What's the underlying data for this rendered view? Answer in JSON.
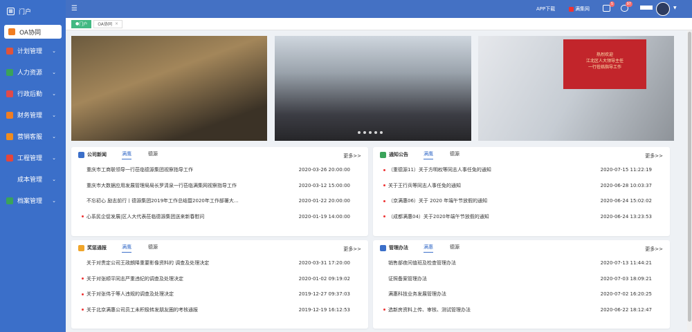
{
  "sidebar": {
    "home": "门户",
    "active": "OA协同",
    "items": [
      {
        "label": "计划管理",
        "color": "#e0533a"
      },
      {
        "label": "人力资源",
        "color": "#3aa35a"
      },
      {
        "label": "行政后勤",
        "color": "#e04a4a"
      },
      {
        "label": "财务管理",
        "color": "#f07d22"
      },
      {
        "label": "营销客服",
        "color": "#f08c1e"
      },
      {
        "label": "工程管理",
        "color": "#e5453a"
      },
      {
        "label": "成本管理",
        "color": "#3b6fc9"
      },
      {
        "label": "档案管理",
        "color": "#3aa35a"
      }
    ]
  },
  "topbar": {
    "app": "APP下载",
    "brand": "满集网",
    "msg_badge": "5",
    "user_badge": "97"
  },
  "tabs": [
    {
      "label": "门户"
    },
    {
      "label": "OA协同"
    }
  ],
  "banner3_text": "热烈欢迎\n江北区人大领导主任\n一行莅临指导工作",
  "more": "更多>>",
  "cards": [
    {
      "title": "公司新闻",
      "tab1": "满鹰",
      "tab2": "德源",
      "color": "#3b6fc9",
      "rows": [
        {
          "t": "重庆市工商联领导一行莅临德源集团视察指导工作",
          "d": "2020-03-26 20:00:00",
          "dot": false
        },
        {
          "t": "重庆市大数据应用发展管理局局长罗清泉一行莅临满集网视察指导工作",
          "d": "2020-03-12 15:00:00",
          "dot": false
        },
        {
          "t": "不忘初心 励志前行丨德源集团2019年工作总结暨2020年工作部署大...",
          "d": "2020-01-22 20:00:00",
          "dot": false
        },
        {
          "t": "心系民企促发展|区人大代表莅临德源集团送来新春慰问",
          "d": "2020-01-19 14:00:00",
          "dot": true
        }
      ]
    },
    {
      "title": "通知公告",
      "tab1": "满鹰",
      "tab2": "德源",
      "color": "#3aa35a",
      "rows": [
        {
          "t": "（重德源11）关于方明权等同志人事任免的通知",
          "d": "2020-07-15 11:22:19",
          "dot": true
        },
        {
          "t": "关于王行兵等同志人事任免的通知",
          "d": "2020-06-28 10:03:37",
          "dot": true
        },
        {
          "t": "（京满惠06）关于 2020 年端午节放假的通知",
          "d": "2020-06-24 15:02:02",
          "dot": true
        },
        {
          "t": "（成都满惠04）关于2020年端午节放假的通知",
          "d": "2020-06-24 13:23:53",
          "dot": true
        }
      ]
    },
    {
      "title": "奖惩通报",
      "tab1": "满鹰",
      "tab2": "德源",
      "color": "#f0a52a",
      "rows": [
        {
          "t": "关于对贵定公司王政朗降重要影像资料的 调查及处理决定",
          "d": "2020-03-31 17:20:00",
          "dot": false
        },
        {
          "t": "关于对张顺平同志严重违纪的调查及处理决定",
          "d": "2020-01-02 09:19:02",
          "dot": true
        },
        {
          "t": "关于对张伟于等人违规的调查及处理决定",
          "d": "2019-12-27 09:37:03",
          "dot": true
        },
        {
          "t": "关于北京满惠公司员工未积极转发朋友圈的考核通报",
          "d": "2019-12-19 16:12:53",
          "dot": true
        }
      ]
    },
    {
      "title": "管理办法",
      "tab1": "满惠",
      "tab2": "德源",
      "color": "#3b6fc9",
      "rows": [
        {
          "t": "销售部夜间值班及检查管理办法",
          "d": "2020-07-13 11:44:21",
          "dot": false
        },
        {
          "t": "证照备案管理办法",
          "d": "2020-07-03 18:09:21",
          "dot": false
        },
        {
          "t": "满惠科技业务发展管理办法",
          "d": "2020-07-02 16:20:25",
          "dot": false
        },
        {
          "t": "选新房资料上传、审核、测试管理办法",
          "d": "2020-06-22 18:12:47",
          "dot": true
        }
      ]
    }
  ]
}
